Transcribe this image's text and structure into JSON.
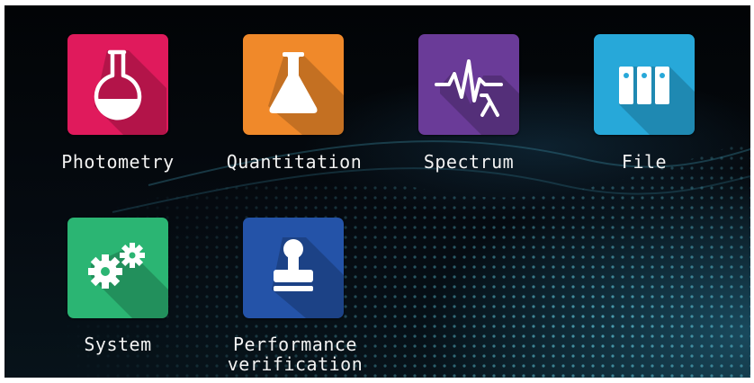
{
  "apps": [
    {
      "label": "Photometry",
      "icon": "round-flask-icon",
      "color": "#e01a5c"
    },
    {
      "label": "Quantitation",
      "icon": "conical-flask-icon",
      "color": "#f0892a"
    },
    {
      "label": "Spectrum",
      "icon": "waveform-lambda-icon",
      "color": "#6a3b98"
    },
    {
      "label": "File",
      "icon": "binders-icon",
      "color": "#27a8d9"
    },
    {
      "label": "System",
      "icon": "gears-icon",
      "color": "#2bb573"
    },
    {
      "label": "Performance\nverification",
      "icon": "stamp-icon",
      "color": "#2453a8"
    }
  ]
}
